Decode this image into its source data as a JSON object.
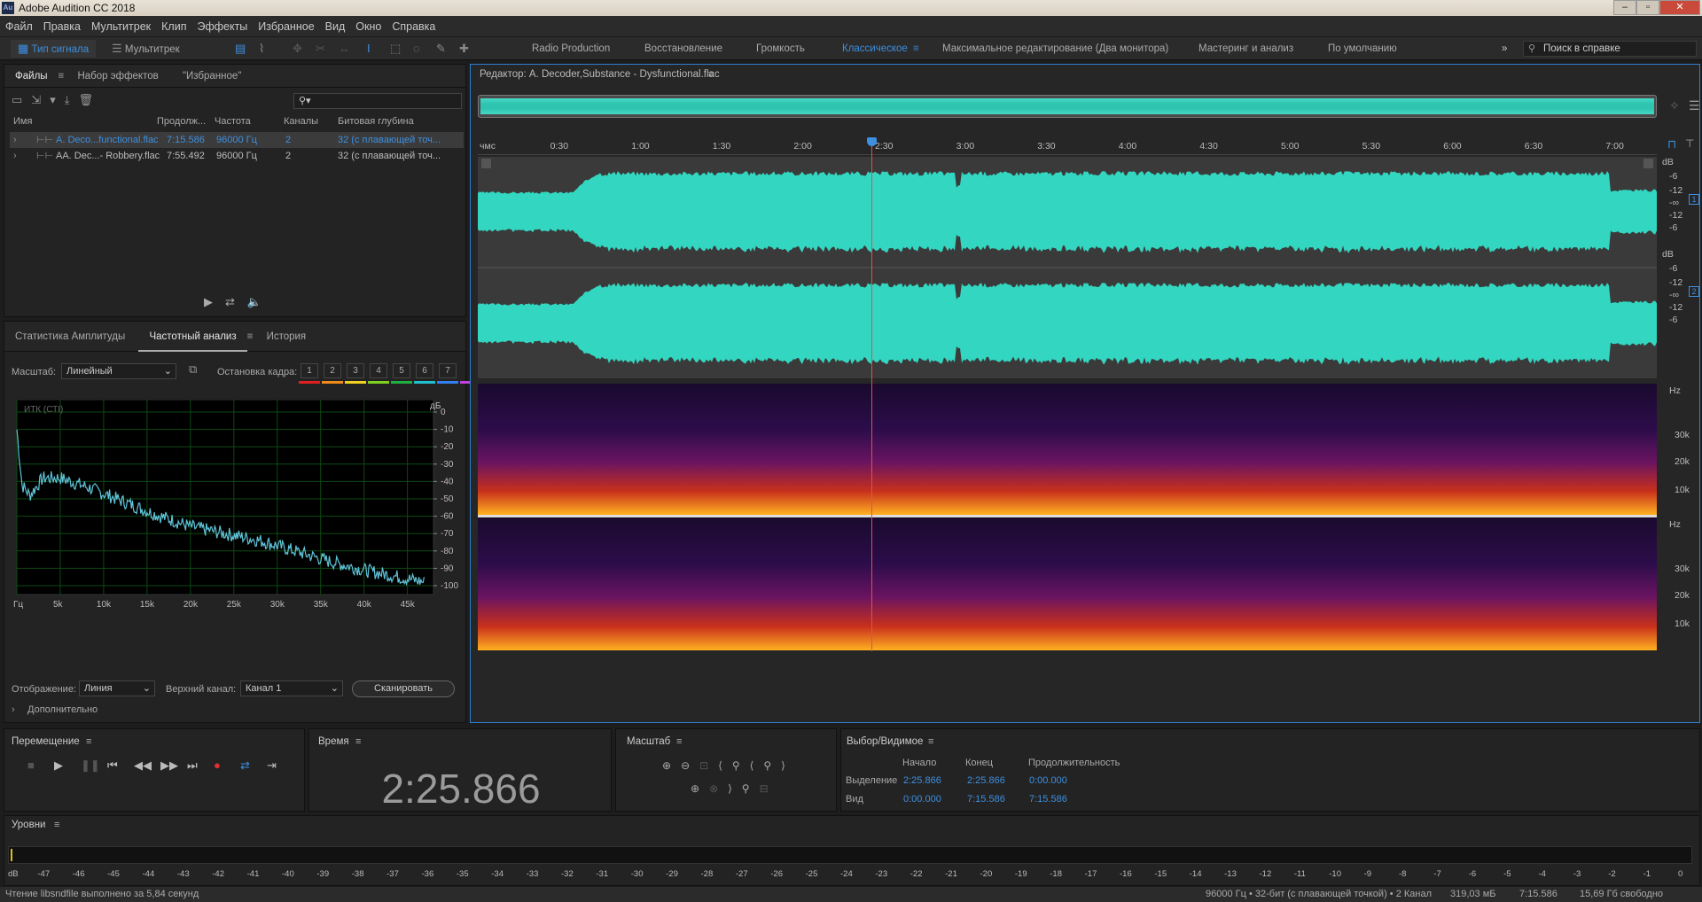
{
  "window": {
    "app_title": "Adobe Audition CC 2018",
    "logo": "Au"
  },
  "menu": [
    "Файл",
    "Правка",
    "Мультитрек",
    "Клип",
    "Эффекты",
    "Избранное",
    "Вид",
    "Окно",
    "Справка"
  ],
  "toolbar": {
    "waveform_label": "Тип сигнала",
    "multitrack_label": "Мультитрек",
    "workspaces": [
      "Radio Production",
      "Восстановление",
      "Громкость",
      "Классическое",
      "Максимальное редактирование (Два монитора)",
      "Мастеринг и анализ",
      "По умолчанию"
    ],
    "active_workspace": "Классическое",
    "help_search_placeholder": "Поиск в справке"
  },
  "files_panel": {
    "tabs": [
      "Файлы",
      "Набор эффектов",
      "\"Избранное\""
    ],
    "columns": [
      "Имя",
      "Продолж...",
      "Частота",
      "Каналы",
      "Битовая глубина"
    ],
    "rows": [
      {
        "name": "A. Deco...functional.flac",
        "duration": "7:15.586",
        "rate": "96000 Гц",
        "channels": "2",
        "bitdepth": "32 (с плавающей точ..."
      },
      {
        "name": "AA. Dec...- Robbery.flac",
        "duration": "7:55.492",
        "rate": "96000 Гц",
        "channels": "2",
        "bitdepth": "32 (с плавающей точ..."
      }
    ]
  },
  "analysis_panel": {
    "tabs": [
      "Статистика Амплитуды",
      "Частотный анализ",
      "История"
    ],
    "scale_label": "Масштаб:",
    "scale_value": "Линейный",
    "freeze_label": "Остановка кадра:",
    "freeze_buttons": [
      "1",
      "2",
      "3",
      "4",
      "5",
      "6",
      "7"
    ],
    "freeze_colors": [
      "#e02020",
      "#f08a1a",
      "#f0d020",
      "#80d020",
      "#20b040",
      "#20c0d0",
      "#3080f0",
      "#c040e0"
    ],
    "chart_corner_label": "ИТК (СТI)",
    "display_label": "Отображение:",
    "display_value": "Линия",
    "channel_label": "Верхний канал:",
    "channel_value": "Канал 1",
    "scan_button": "Сканировать",
    "more_label": "Дополнительно"
  },
  "chart_data": {
    "type": "line",
    "xlabel": "Гц",
    "ylabel": "дБ",
    "x_ticks": [
      "Гц",
      "5k",
      "10k",
      "15k",
      "20k",
      "25k",
      "30k",
      "35k",
      "40k",
      "45k"
    ],
    "y_ticks": [
      "0",
      "-10",
      "-20",
      "-30",
      "-40",
      "-50",
      "-60",
      "-70",
      "-80",
      "-90",
      "-100"
    ],
    "ylim": [
      -100,
      5
    ],
    "xlim": [
      0,
      48000
    ],
    "series": [
      {
        "values": [
          [
            0,
            -10
          ],
          [
            600,
            -42
          ],
          [
            1500,
            -48
          ],
          [
            3000,
            -38
          ],
          [
            5000,
            -38
          ],
          [
            8000,
            -43
          ],
          [
            10000,
            -47
          ],
          [
            13000,
            -53
          ],
          [
            16000,
            -59
          ],
          [
            20000,
            -66
          ],
          [
            24000,
            -70
          ],
          [
            28000,
            -74
          ],
          [
            32000,
            -80
          ],
          [
            36000,
            -86
          ],
          [
            40000,
            -91
          ],
          [
            44000,
            -95
          ],
          [
            47000,
            -98
          ]
        ]
      }
    ]
  },
  "editor": {
    "title": "Редактор: A. Decoder,Substance - Dysfunctional.flac",
    "ruler_unit": "чмс",
    "ruler_ticks": [
      "0:30",
      "1:00",
      "1:30",
      "2:00",
      "2:30",
      "3:00",
      "3:30",
      "4:00",
      "4:30",
      "5:00",
      "5:30",
      "6:00",
      "6:30",
      "7:00"
    ],
    "db_labels": [
      "dB",
      "-6",
      "-12",
      "-∞",
      "-12",
      "-6"
    ],
    "channel_badges": [
      "1",
      "2"
    ],
    "hz_label": "Hz",
    "hz_ticks": [
      "30k",
      "20k",
      "10k"
    ],
    "playhead_fraction": 0.3341
  },
  "transport": {
    "title": "Перемещение"
  },
  "time_panel": {
    "title": "Время",
    "value": "2:25.866"
  },
  "zoom_panel": {
    "title": "Масштаб"
  },
  "selection_panel": {
    "title": "Выбор/Видимое",
    "cols": [
      "Начало",
      "Конец",
      "Продолжительность"
    ],
    "rows": [
      {
        "label": "Выделение",
        "start": "2:25.866",
        "end": "2:25.866",
        "dur": "0:00.000"
      },
      {
        "label": "Вид",
        "start": "0:00.000",
        "end": "7:15.586",
        "dur": "7:15.586"
      }
    ]
  },
  "levels_panel": {
    "title": "Уровни",
    "scale": [
      "dB",
      "-47",
      "-46",
      "-45",
      "-44",
      "-43",
      "-42",
      "-41",
      "-40",
      "-39",
      "-38",
      "-37",
      "-36",
      "-35",
      "-34",
      "-33",
      "-32",
      "-31",
      "-30",
      "-29",
      "-28",
      "-27",
      "-26",
      "-25",
      "-24",
      "-23",
      "-22",
      "-21",
      "-20",
      "-19",
      "-18",
      "-17",
      "-16",
      "-15",
      "-14",
      "-13",
      "-12",
      "-11",
      "-10",
      "-9",
      "-8",
      "-7",
      "-6",
      "-5",
      "-4",
      "-3",
      "-2",
      "-1",
      "0"
    ]
  },
  "status": {
    "left": "Чтение libsndfile выполнено за 5,84 секунд",
    "format": "96000 Гц • 32-бит (с плавающей точкой) • 2 Канал",
    "size": "319,03 мБ",
    "duration": "7:15.586",
    "free": "15,69 Гб свободно"
  }
}
